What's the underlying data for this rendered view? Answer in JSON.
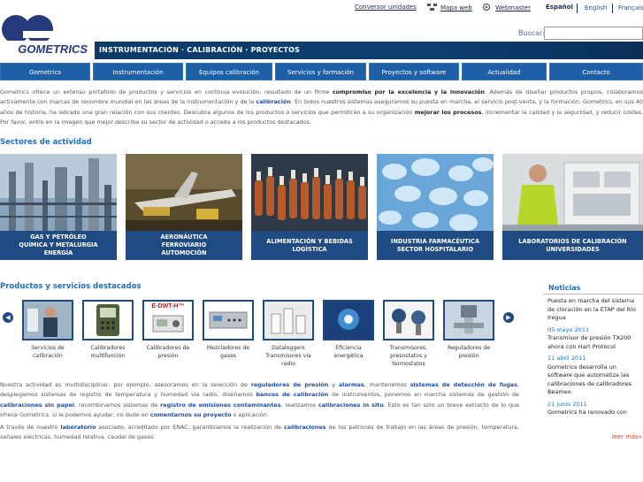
{
  "top_links": {
    "converter": "Conversor unidades",
    "sitemap": "Mapa web",
    "webmaster": "Webmaster"
  },
  "languages": [
    "Español",
    "English",
    "Français"
  ],
  "logo_text": "GOMETRICS",
  "tagline": "INSTRUMENTACIÓN · CALIBRACIÓN · PROYECTOS",
  "search": {
    "label": "Buscar:",
    "value": ""
  },
  "nav": [
    "Gometrics",
    "Instrumentación",
    "Equipos calibración",
    "Servicios y formación",
    "Proyectos y software",
    "Actualidad",
    "Contacto"
  ],
  "intro": {
    "p1": "Gometrics ofrece un extenso portafolio de productos y servicios en continua evolución, resultado de un firme",
    "b1": "compromiso por la excelencia",
    "p2": "y",
    "b2": "la innovación",
    "p3": ". Además de diseñar productos propios, colaboramos activamente con marcas de renombre mundial en las áreas de la instrumentación y de la",
    "l1": "calibración",
    "p4": ". En todos nuestros sistemas aseguramos su puesta en marcha, el servicio post-venta, y la formación. Gometrics, en sus 40 años de historia, ha labrado una gran relación con sus clientes. Descubra algunos de los productos o servicios que permitirán a su organización",
    "b3": "mejorar los procesos",
    "p5": ", incrementar la calidad y la seguridad, y reducir costes. Por favor, entre en la imagen que mejor describa su sector de actividad o acceda a los productos destacados."
  },
  "sectors_title": "Sectores de actividad",
  "sectors": [
    {
      "line1": "GAS Y PETRÓLEO",
      "line2": "QUÍMICA Y METALURGIA",
      "line3": "ENERGÍA"
    },
    {
      "line1": "AERONÁUTICA",
      "line2": "FERROVIARIO",
      "line3": "AUTOMOCIÓN"
    },
    {
      "line1": "ALIMENTACIÓN Y BEBIDAS",
      "line2": "LOGÍSTICA",
      "line3": ""
    },
    {
      "line1": "INDUSTRIA FARMACÉUTICA",
      "line2": "SECTOR HOSPITALARIO",
      "line3": ""
    },
    {
      "line1": "LABORATORIOS DE CALIBRACIÓN",
      "line2": "UNIVERSIDADES",
      "line3": ""
    }
  ],
  "products_title": "Productos y servicios destacados",
  "products": [
    {
      "label": "Servicios de calibración"
    },
    {
      "label": "Calibradores multifunción"
    },
    {
      "label": "Calibradores de presión",
      "badge": "E-DWT-H™"
    },
    {
      "label": "Mezcladores de gases"
    },
    {
      "label": "Dataloggers Transmisores vía radio"
    },
    {
      "label": "Eficiencia energética"
    },
    {
      "label": "Transmisores, presostatos y termostatos"
    },
    {
      "label": "Reguladores de presión"
    }
  ],
  "body": {
    "s1": "Nuestra actividad es multidisciplinar: por ejemplo, asesoramos en la selección de",
    "k1": "reguladores de presión",
    "s2": "y",
    "k2": "alarmas",
    "s3": ", mantenemos",
    "k3": "sistemas de detección de fugas",
    "s4": ", desplegamos sistemas de registro de temperatura y humedad vía radio, diseñamos",
    "k4": "bancos de calibración",
    "s5": "de instrumentos, ponemos en marcha sistemas de gestión de",
    "k5": "calibraciones sin papel",
    "s6": ", recombinamos sistemas de",
    "k6": "registro de emisiones contaminantes",
    "s7": ", realizamos",
    "k7": "calibraciones in situ",
    "s8": ". Esto es tan sólo un breve extracto de lo que ofrece Gometrics: si le podemos ayudar, no dude en",
    "k8": "comentarnos su proyecto",
    "s9": "o aplicación.",
    "t1": "A través de nuestro",
    "k9": "laboratorio",
    "t2": "asociado, acreditado por ENAC, garantizamos la realización de",
    "k10": "calibraciones",
    "t3": "de los patrones de trabajo en las áreas de presión, temperatura, señales eléctricas, humedad relativa, caudal de gases."
  },
  "news": {
    "title": "Noticias",
    "items": [
      {
        "date": "",
        "text": "Puesta en marcha del sistema de cloración en la ETAP del Río Iregua"
      },
      {
        "date": "05 mayo 2011",
        "text": "Transmisor de presión TX200 ahora con Hart Protocol"
      },
      {
        "date": "11 abril 2011",
        "text": "Gometrics desarrolla un software que automatiza las calibraciones de calibradores Beamex"
      },
      {
        "date": "21 junio 2011",
        "text": "Gometrics ha renovado con"
      }
    ],
    "more": "leer más»"
  },
  "colors": {
    "nav": "#1e5fa8",
    "dark_blue": "#1f4b82",
    "heading": "#1e6fc0",
    "accent_red": "#c0392b"
  }
}
